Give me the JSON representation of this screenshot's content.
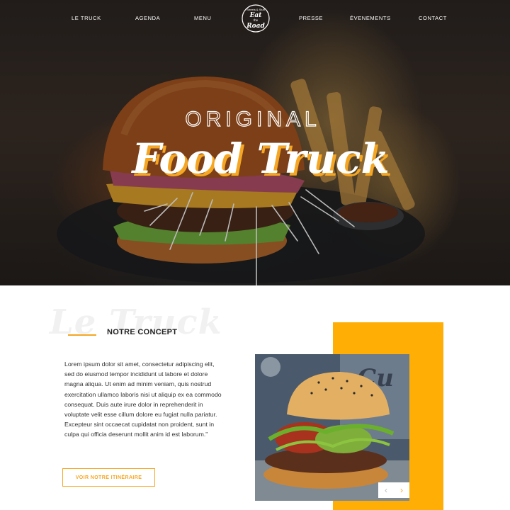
{
  "nav": {
    "items": [
      "LE TRUCK",
      "AGENDA",
      "MENU",
      "PRESSE",
      "ÉVENEMENTS",
      "CONTACT"
    ],
    "logo_text": [
      "Streets & Stuff",
      "Eat",
      "the",
      "Road"
    ]
  },
  "hero": {
    "title_small": "ORIGINAL",
    "title_main": "Food Truck"
  },
  "concept": {
    "watermark": "Le Truck",
    "title": "NOTRE CONCEPT",
    "paragraph": "Lorem ipsum dolor sit amet, consectetur adipiscing elit, sed do eiusmod tempor incididunt ut labore et dolore magna aliqua. Ut enim ad minim veniam, quis nostrud exercitation ullamco laboris nisi ut aliquip ex ea commodo consequat. Duis aute irure dolor in reprehenderit in voluptate velit esse cillum dolore eu fugiat nulla pariatur. Excepteur sint occaecat cupidatat non proident, sunt in culpa qui officia deserunt mollit anim id est laborum.\"",
    "cta_label": "VOIR NOTRE ITINÉRAIRE"
  },
  "slider": {
    "prev_icon": "chevron-left-icon",
    "next_icon": "chevron-right-icon",
    "prev_glyph": "‹",
    "next_glyph": "›"
  },
  "colors": {
    "accent": "#f5a623",
    "block": "#ffae06"
  }
}
